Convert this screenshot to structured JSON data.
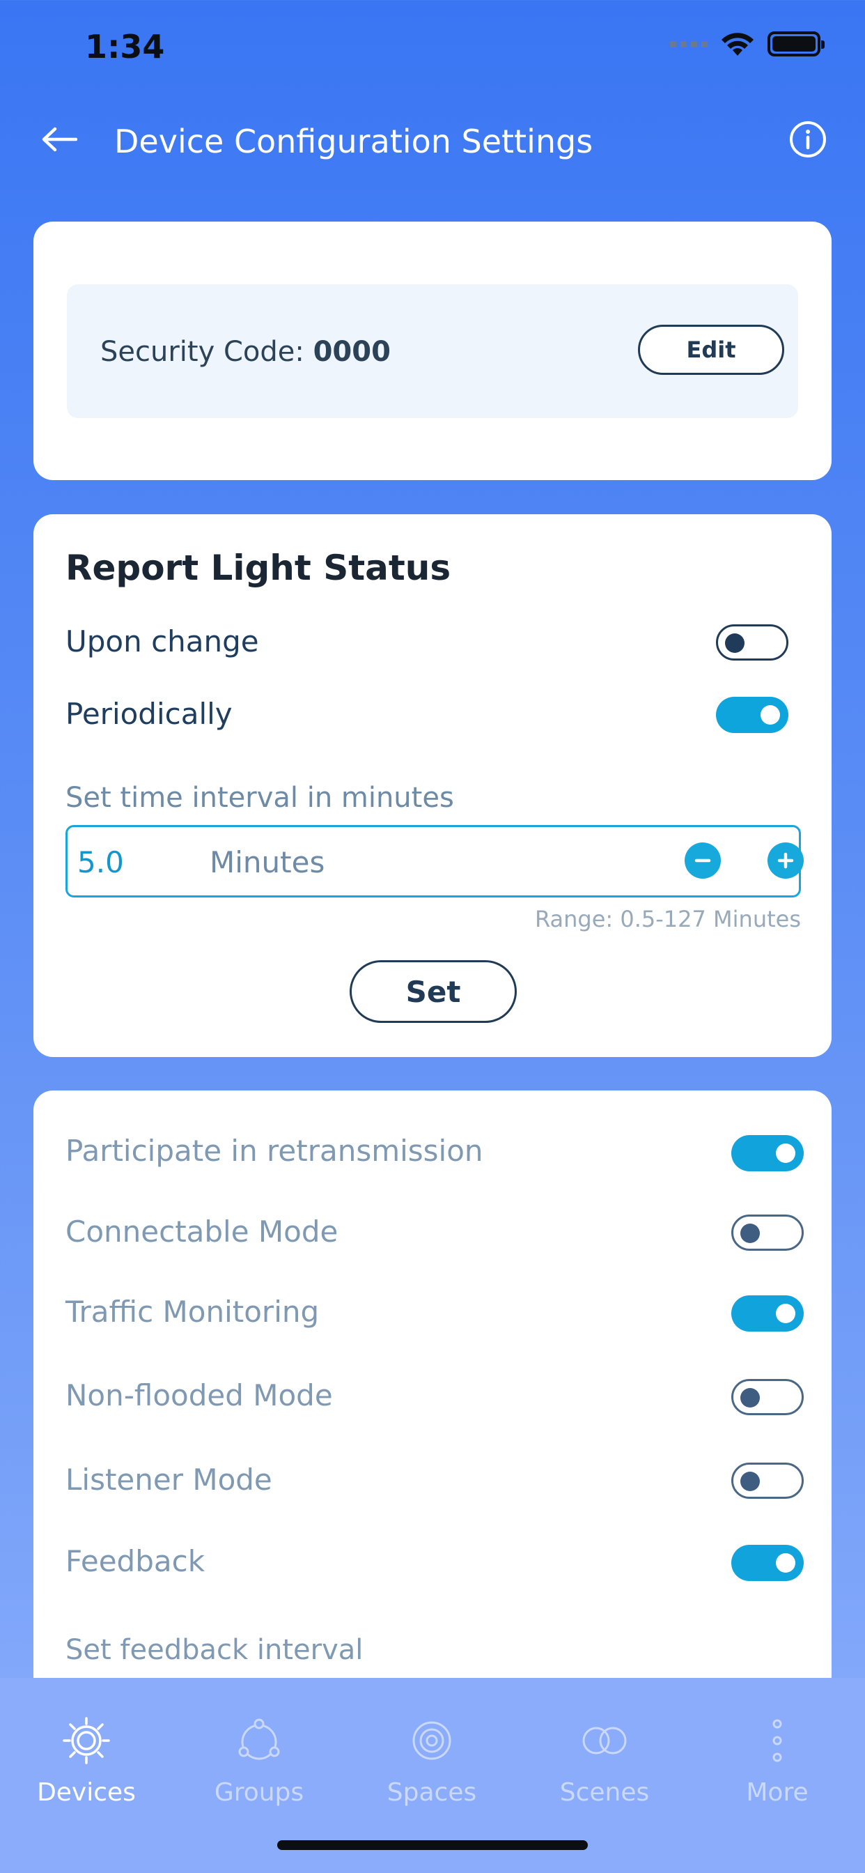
{
  "status_bar": {
    "time": "1:34"
  },
  "header": {
    "title": "Device Configuration Settings"
  },
  "security": {
    "label": "Security Code: ",
    "code": "0000",
    "edit_label": "Edit"
  },
  "report": {
    "title": "Report Light Status",
    "upon_change": {
      "label": "Upon change",
      "on": false
    },
    "periodically": {
      "label": "Periodically",
      "on": true
    },
    "interval_label": "Set time interval in minutes",
    "interval_value": "5.0",
    "interval_unit": "Minutes",
    "range": "Range: 0.5-127 Minutes",
    "set_label": "Set"
  },
  "settings": {
    "rows": [
      {
        "label": "Participate in retransmission",
        "on": true
      },
      {
        "label": "Connectable Mode",
        "on": false
      },
      {
        "label": "Traffic Monitoring",
        "on": true
      },
      {
        "label": "Non-flooded Mode",
        "on": false
      },
      {
        "label": "Listener Mode",
        "on": false
      },
      {
        "label": "Feedback",
        "on": true
      }
    ],
    "feedback_interval_label": "Set feedback interval"
  },
  "nav": {
    "items": [
      {
        "label": "Devices",
        "icon": "gear-icon",
        "active": true
      },
      {
        "label": "Groups",
        "icon": "groups-icon",
        "active": false
      },
      {
        "label": "Spaces",
        "icon": "spaces-icon",
        "active": false
      },
      {
        "label": "Scenes",
        "icon": "scenes-icon",
        "active": false
      },
      {
        "label": "More",
        "icon": "more-icon",
        "active": false
      }
    ]
  },
  "colors": {
    "accent": "#0ea5dd",
    "background": "#3a76f3",
    "dark_text": "#213a55"
  }
}
